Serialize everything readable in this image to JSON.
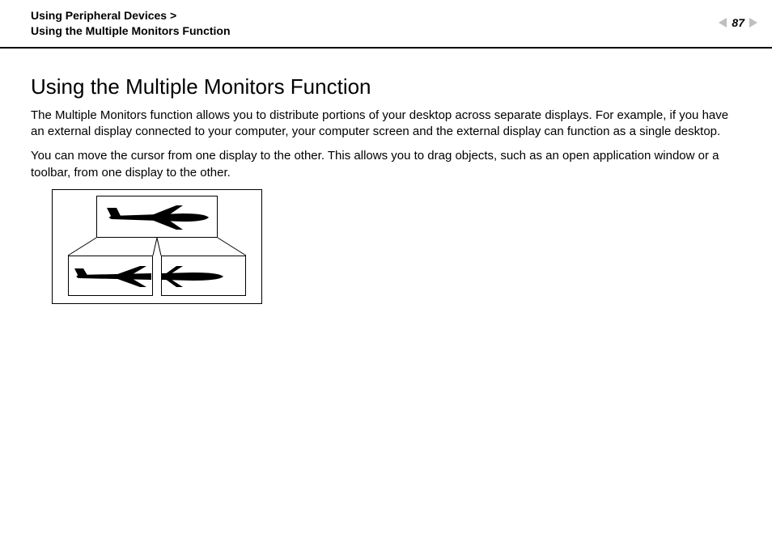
{
  "header": {
    "breadcrumb_line1": "Using Peripheral Devices",
    "breadcrumb_sep": ">",
    "breadcrumb_line2": "Using the Multiple Monitors Function",
    "page_number": "87"
  },
  "body": {
    "title": "Using the Multiple Monitors Function",
    "para1": "The Multiple Monitors function allows you to distribute portions of your desktop across separate displays. For example, if you have an external display connected to your computer, your computer screen and the external display can function as a single desktop.",
    "para2": "You can move the cursor from one display to the other. This allows you to drag objects, such as an open application window or a toolbar, from one display to the other."
  },
  "figure": {
    "description": "Illustration of one large window split into two smaller monitor views showing parts of an airplane silhouette",
    "icons": {
      "top": "airplane-silhouette-full",
      "bottom_left": "airplane-silhouette-left-half",
      "bottom_right": "airplane-silhouette-right-half"
    }
  }
}
